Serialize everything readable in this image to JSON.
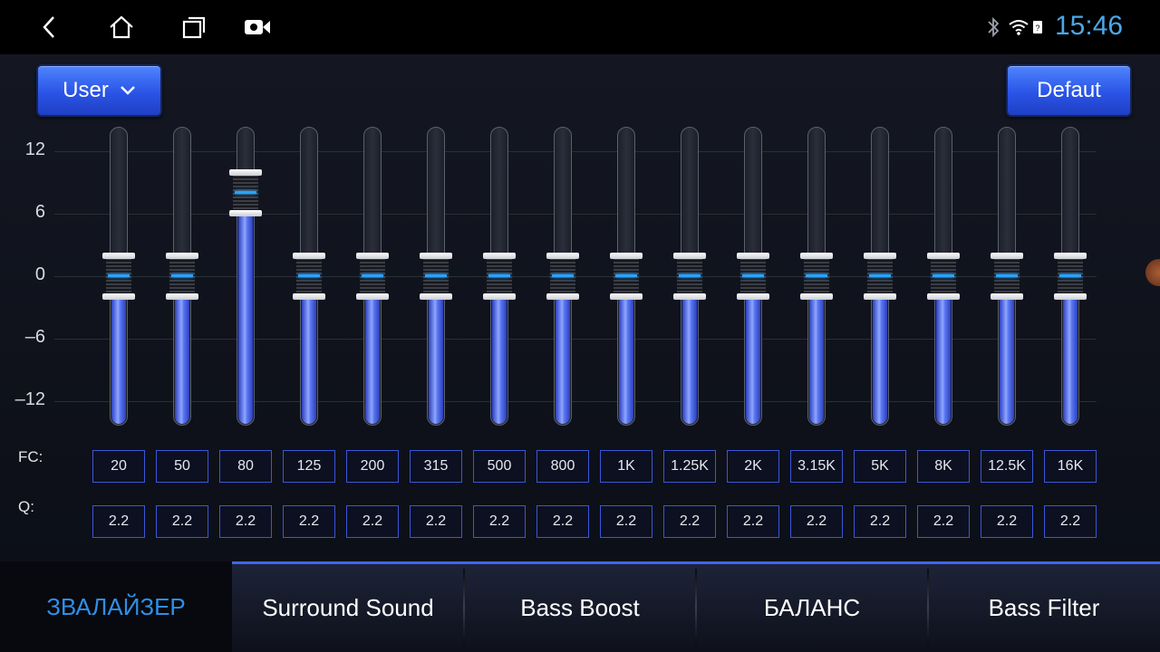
{
  "statusbar": {
    "time": "15:46",
    "icons": [
      "back-icon",
      "home-icon",
      "recent-apps-icon",
      "video-camera-icon",
      "bluetooth-icon",
      "wifi-icon",
      "sim-icon"
    ]
  },
  "equalizer": {
    "preset_label": "User",
    "default_label": "Defaut",
    "y_ticks": [
      "12",
      "6",
      "0",
      "–6",
      "–12"
    ],
    "fc_label": "FC:",
    "q_label": "Q:",
    "bands": [
      {
        "fc": "20",
        "q": "2.2",
        "gain": 0
      },
      {
        "fc": "50",
        "q": "2.2",
        "gain": 0
      },
      {
        "fc": "80",
        "q": "2.2",
        "gain": 8
      },
      {
        "fc": "125",
        "q": "2.2",
        "gain": 0
      },
      {
        "fc": "200",
        "q": "2.2",
        "gain": 0
      },
      {
        "fc": "315",
        "q": "2.2",
        "gain": 0
      },
      {
        "fc": "500",
        "q": "2.2",
        "gain": 0
      },
      {
        "fc": "800",
        "q": "2.2",
        "gain": 0
      },
      {
        "fc": "1K",
        "q": "2.2",
        "gain": 0
      },
      {
        "fc": "1.25K",
        "q": "2.2",
        "gain": 0
      },
      {
        "fc": "2K",
        "q": "2.2",
        "gain": 0
      },
      {
        "fc": "3.15K",
        "q": "2.2",
        "gain": 0
      },
      {
        "fc": "5K",
        "q": "2.2",
        "gain": 0
      },
      {
        "fc": "8K",
        "q": "2.2",
        "gain": 0
      },
      {
        "fc": "12.5K",
        "q": "2.2",
        "gain": 0
      },
      {
        "fc": "16K",
        "q": "2.2",
        "gain": 0
      }
    ]
  },
  "tabs": [
    {
      "label": "ЗВАЛАЙЗЕР",
      "active": true
    },
    {
      "label": "Surround Sound",
      "active": false
    },
    {
      "label": "Bass Boost",
      "active": false
    },
    {
      "label": "БАЛАНС",
      "active": false
    },
    {
      "label": "Bass Filter",
      "active": false
    }
  ],
  "colors": {
    "accent": "#2f8fe6",
    "clock": "#4aa8e8",
    "slider_fill": "#5c77f0",
    "knob_indicator": "#29a3ff"
  }
}
